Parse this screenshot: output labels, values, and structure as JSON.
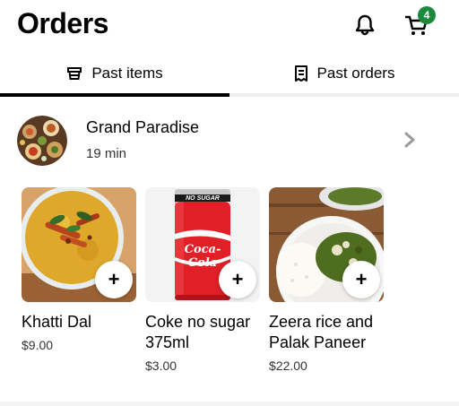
{
  "header": {
    "title": "Orders",
    "cart_count": "4"
  },
  "tabs": [
    {
      "label": "Past items",
      "icon": "basket-icon",
      "active": true
    },
    {
      "label": "Past orders",
      "icon": "receipt-icon",
      "active": false
    }
  ],
  "store": {
    "name": "Grand Paradise",
    "time": "19 min"
  },
  "items": [
    {
      "name": "Khatti  Dal",
      "price": "$9.00",
      "image": "khatti-dal"
    },
    {
      "name": "Coke no sugar 375ml",
      "price": "$3.00",
      "image": "coke-can",
      "can_small_text": "NO SUGAR",
      "can_logo": "Coca-Cola"
    },
    {
      "name": "Zeera rice and Palak Paneer",
      "price": "$22.00",
      "image": "rice-palak"
    }
  ],
  "colors": {
    "accent": "#000000",
    "badge": "#1b8a3d",
    "can_red": "#e01f26"
  }
}
